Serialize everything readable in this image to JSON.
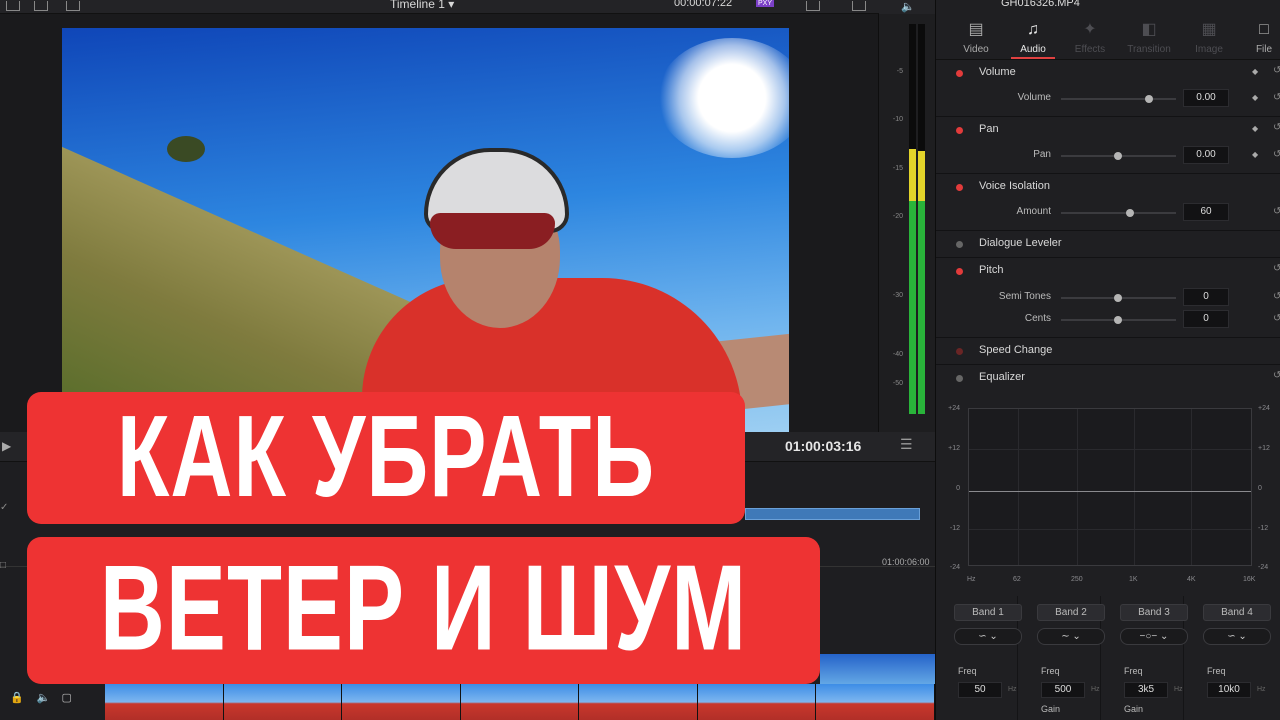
{
  "topbar": {
    "timeline_title": "Timeline 1 ▾",
    "timecode": "00:00:07:22",
    "proxy_badge": "PXY"
  },
  "meters": {
    "scale": [
      "-5",
      "-10",
      "-15",
      "-20",
      "-30",
      "-40",
      "-50"
    ],
    "colors": {
      "green": "#29b43a",
      "yellow": "#e3d42a"
    }
  },
  "timeline": {
    "current_timecode": "01:00:03:16",
    "ruler_timecode": "01:00:06:00"
  },
  "headline": {
    "line1": "КАК УБРАТЬ",
    "line2": "ВЕТЕР И ШУМ",
    "bg_color": "#ee3333"
  },
  "inspector": {
    "clip_name": "GH016326.MP4",
    "tabs": [
      {
        "label": "Video",
        "icon": "film-icon"
      },
      {
        "label": "Audio",
        "icon": "music-note-icon"
      },
      {
        "label": "Effects",
        "icon": "magic-wand-icon"
      },
      {
        "label": "Transition",
        "icon": "transition-icon"
      },
      {
        "label": "Image",
        "icon": "image-icon"
      },
      {
        "label": "File",
        "icon": "file-icon"
      }
    ],
    "sections": {
      "volume": {
        "name": "Volume",
        "param_label": "Volume",
        "value": "0.00"
      },
      "pan": {
        "name": "Pan",
        "param_label": "Pan",
        "value": "0.00"
      },
      "voice_isolation": {
        "name": "Voice Isolation",
        "param_label": "Amount",
        "value": "60"
      },
      "dialogue_leveler": {
        "name": "Dialogue Leveler"
      },
      "pitch": {
        "name": "Pitch",
        "semi_label": "Semi Tones",
        "semi_value": "0",
        "cents_label": "Cents",
        "cents_value": "0"
      },
      "speed_change": {
        "name": "Speed Change"
      },
      "equalizer": {
        "name": "Equalizer"
      }
    },
    "eq": {
      "y_labels": [
        "+24",
        "+12",
        "0",
        "-12",
        "-24"
      ],
      "x_labels": [
        "Hz",
        "62",
        "250",
        "1K",
        "4K",
        "16K"
      ]
    },
    "bands": [
      {
        "label": "Band 1",
        "freq_label": "Freq",
        "freq": "50",
        "unit": "Hz",
        "gain_label": ""
      },
      {
        "label": "Band 2",
        "freq_label": "Freq",
        "freq": "500",
        "unit": "Hz",
        "gain_label": "Gain"
      },
      {
        "label": "Band 3",
        "freq_label": "Freq",
        "freq": "3k5",
        "unit": "Hz",
        "gain_label": "Gain"
      },
      {
        "label": "Band 4",
        "freq_label": "Freq",
        "freq": "10k0",
        "unit": "Hz",
        "gain_label": ""
      }
    ]
  }
}
